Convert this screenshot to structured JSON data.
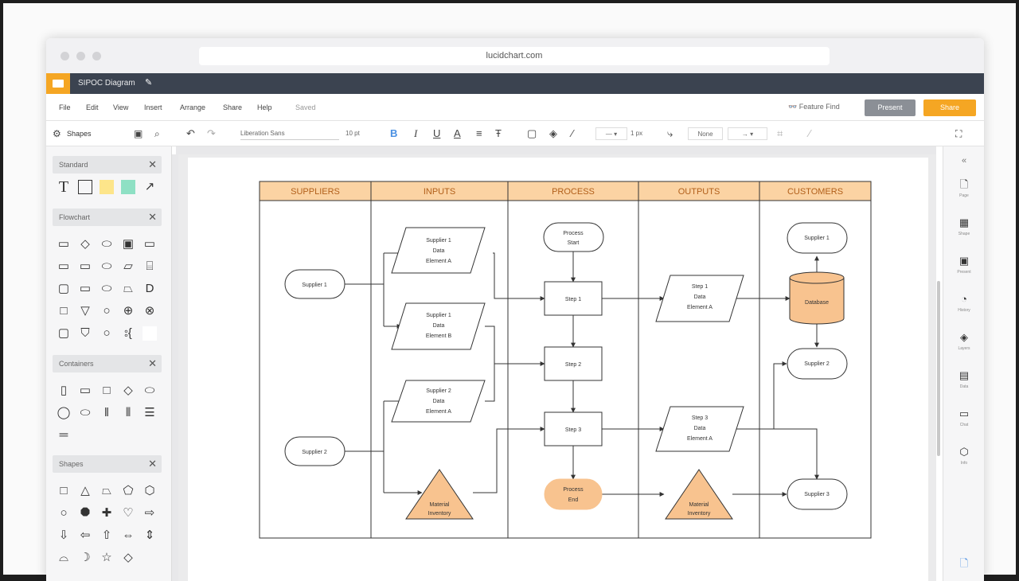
{
  "browser": {
    "url": "lucidchart.com"
  },
  "document": {
    "title": "SIPOC Diagram"
  },
  "menu": {
    "items": [
      "File",
      "Edit",
      "View",
      "Insert",
      "Arrange",
      "Share",
      "Help"
    ],
    "last_edit": "Saved",
    "share_hint": "Feature Find",
    "present_label": "Present",
    "share_label": "Share"
  },
  "toolbar": {
    "shapes_label": "Shapes",
    "font": "Liberation Sans",
    "font_size": "10 pt",
    "line_width": "1 px",
    "line_style": "None"
  },
  "left_panel": {
    "sections": [
      {
        "title": "Standard"
      },
      {
        "title": "Flowchart"
      },
      {
        "title": "Containers"
      },
      {
        "title": "Shapes"
      }
    ]
  },
  "right_panel": {
    "items": [
      {
        "icon": "page-icon",
        "label": "Page"
      },
      {
        "icon": "shape-icon",
        "label": "Shape"
      },
      {
        "icon": "presentation-icon",
        "label": "Present"
      },
      {
        "icon": "history-icon",
        "label": "History"
      },
      {
        "icon": "layers-icon",
        "label": "Layers"
      },
      {
        "icon": "data-icon",
        "label": "Data"
      },
      {
        "icon": "comment-icon",
        "label": "Chat"
      },
      {
        "icon": "info-icon",
        "label": "Info"
      }
    ]
  },
  "diagram": {
    "headers": [
      "SUPPLIERS",
      "INPUTS",
      "PROCESS",
      "OUTPUTS",
      "CUSTOMERS"
    ],
    "supplier_1": "Supplier 1",
    "supplier_2": "Supplier 2",
    "input_1": [
      "Supplier 1",
      "Data",
      "Element A"
    ],
    "input_2": [
      "Supplier 1",
      "Data",
      "Element B"
    ],
    "input_3": [
      "Supplier 2",
      "Data",
      "Element A"
    ],
    "process_start": [
      "Process",
      "Start"
    ],
    "step_1": "Step 1",
    "step_2": "Step 2",
    "step_3": "Step 3",
    "process_end": [
      "Process",
      "End"
    ],
    "material_inventory": [
      "Material",
      "Inventory"
    ],
    "output_1": [
      "Step 1",
      "Data",
      "Element A"
    ],
    "output_2": [
      "Step 3",
      "Data",
      "Element A"
    ],
    "database": "Database",
    "customer_top": "Supplier 1",
    "customer_mid": "Supplier 2",
    "customer_bottom": "Supplier 3",
    "colors": {
      "header": "#fbd3a3",
      "accent": "#f8c38f",
      "stroke": "#333333"
    }
  }
}
